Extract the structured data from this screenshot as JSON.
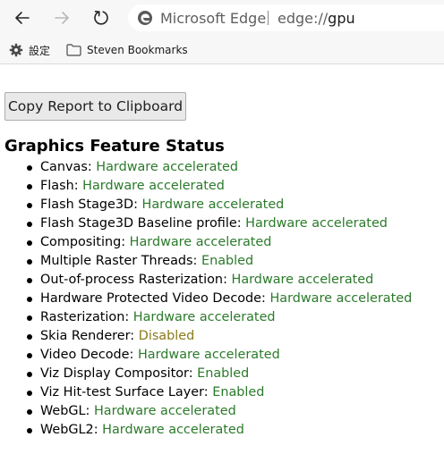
{
  "browser": {
    "site_name": "Microsoft Edge",
    "url_prefix": "edge://",
    "url_host": "gpu"
  },
  "bookmarks": {
    "items": [
      {
        "label": "設定",
        "icon": "gear-icon"
      },
      {
        "label": "Steven Bookmarks",
        "icon": "folder-icon"
      }
    ]
  },
  "page": {
    "copy_button_label": "Copy Report to Clipboard",
    "section_title": "Graphics Feature Status",
    "colors": {
      "accelerated": "#2b7a2b",
      "disabled": "#8a7a1a"
    },
    "features": [
      {
        "name": "Canvas",
        "status": "Hardware accelerated"
      },
      {
        "name": "Flash",
        "status": "Hardware accelerated"
      },
      {
        "name": "Flash Stage3D",
        "status": "Hardware accelerated"
      },
      {
        "name": "Flash Stage3D Baseline profile",
        "status": "Hardware accelerated"
      },
      {
        "name": "Compositing",
        "status": "Hardware accelerated"
      },
      {
        "name": "Multiple Raster Threads",
        "status": "Enabled"
      },
      {
        "name": "Out-of-process Rasterization",
        "status": "Hardware accelerated"
      },
      {
        "name": "Hardware Protected Video Decode",
        "status": "Hardware accelerated"
      },
      {
        "name": "Rasterization",
        "status": "Hardware accelerated"
      },
      {
        "name": "Skia Renderer",
        "status": "Disabled"
      },
      {
        "name": "Video Decode",
        "status": "Hardware accelerated"
      },
      {
        "name": "Viz Display Compositor",
        "status": "Enabled"
      },
      {
        "name": "Viz Hit-test Surface Layer",
        "status": "Enabled"
      },
      {
        "name": "WebGL",
        "status": "Hardware accelerated"
      },
      {
        "name": "WebGL2",
        "status": "Hardware accelerated"
      }
    ]
  }
}
